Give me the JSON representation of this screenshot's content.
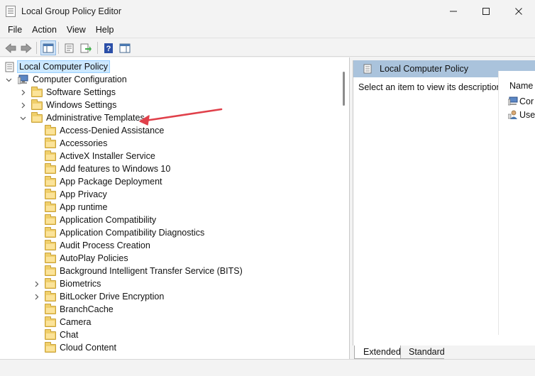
{
  "window": {
    "title": "Local Group Policy Editor"
  },
  "menu": [
    "File",
    "Action",
    "View",
    "Help"
  ],
  "tree": {
    "root": "Local Computer Policy",
    "computer_configuration": "Computer Configuration",
    "software_settings": "Software Settings",
    "windows_settings": "Windows Settings",
    "administrative_templates": "Administrative Templates",
    "templates": [
      "Access-Denied Assistance",
      "Accessories",
      "ActiveX Installer Service",
      "Add features to Windows 10",
      "App Package Deployment",
      "App Privacy",
      "App runtime",
      "Application Compatibility",
      "Application Compatibility Diagnostics",
      "Audit Process Creation",
      "AutoPlay Policies",
      "Background Intelligent Transfer Service (BITS)",
      "Biometrics",
      "BitLocker Drive Encryption",
      "BranchCache",
      "Camera",
      "Chat",
      "Cloud Content"
    ]
  },
  "details": {
    "header": "Local Computer Policy",
    "description": "Select an item to view its description.",
    "column_name": "Name",
    "items": [
      "Cor",
      "Use"
    ]
  },
  "tabs": {
    "extended": "Extended",
    "standard": "Standard"
  },
  "colors": {
    "selection": "#cce8ff",
    "header": "#aac3dc",
    "arrow": "#e0404a",
    "folder": "#f0cf6a"
  }
}
